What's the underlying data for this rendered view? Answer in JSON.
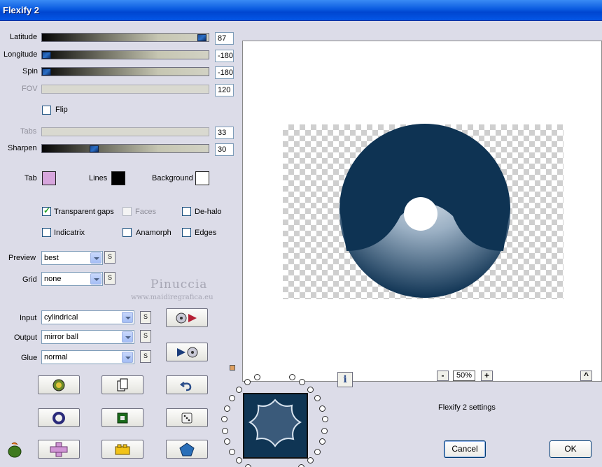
{
  "window": {
    "title": "Flexify 2"
  },
  "sliders": [
    {
      "id": "latitude",
      "label": "Latitude",
      "value": "87",
      "level": 0.96,
      "enabled": true
    },
    {
      "id": "longitude",
      "label": "Longitude",
      "value": "-180",
      "level": 0.0,
      "enabled": true
    },
    {
      "id": "spin",
      "label": "Spin",
      "value": "-180",
      "level": 0.0,
      "enabled": true
    },
    {
      "id": "fov",
      "label": "FOV",
      "value": "120",
      "enabled": false
    },
    {
      "id": "tabs",
      "label": "Tabs",
      "value": "33",
      "enabled": false
    },
    {
      "id": "sharpen",
      "label": "Sharpen",
      "value": "30",
      "level": 0.3,
      "enabled": true
    }
  ],
  "flip": {
    "label": "Flip",
    "checked": false
  },
  "colors": {
    "tab": {
      "label": "Tab",
      "color": "#d7a6dd"
    },
    "lines": {
      "label": "Lines",
      "color": "#000000"
    },
    "background": {
      "label": "Background",
      "color": "#ffffff"
    }
  },
  "options": {
    "transparent_gaps": {
      "label": "Transparent gaps",
      "checked": true
    },
    "faces": {
      "label": "Faces",
      "checked": false,
      "enabled": false
    },
    "de_halo": {
      "label": "De-halo",
      "checked": false
    },
    "indicatrix": {
      "label": "Indicatrix",
      "checked": false
    },
    "anamorph": {
      "label": "Anamorph",
      "checked": false
    },
    "edges": {
      "label": "Edges",
      "checked": false
    }
  },
  "preview_select": {
    "label": "Preview",
    "value": "best"
  },
  "grid_select": {
    "label": "Grid",
    "value": "none"
  },
  "input_select": {
    "label": "Input",
    "value": "cylindrical"
  },
  "output_select": {
    "label": "Output",
    "value": "mirror ball"
  },
  "glue_select": {
    "label": "Glue",
    "value": "normal"
  },
  "s_button_label": "S",
  "watermark": {
    "name": "Pinuccia",
    "site": "www.maidiregrafica.eu"
  },
  "zoom": {
    "value": "50%",
    "minus": "-",
    "plus": "+"
  },
  "status": "Flexify 2 settings",
  "info_label": "i",
  "collapse_label": "^",
  "buttons": {
    "cancel": "Cancel",
    "ok": "OK"
  },
  "theme": {
    "accent": "#0054e3",
    "preview_shape": "#0e3353"
  }
}
